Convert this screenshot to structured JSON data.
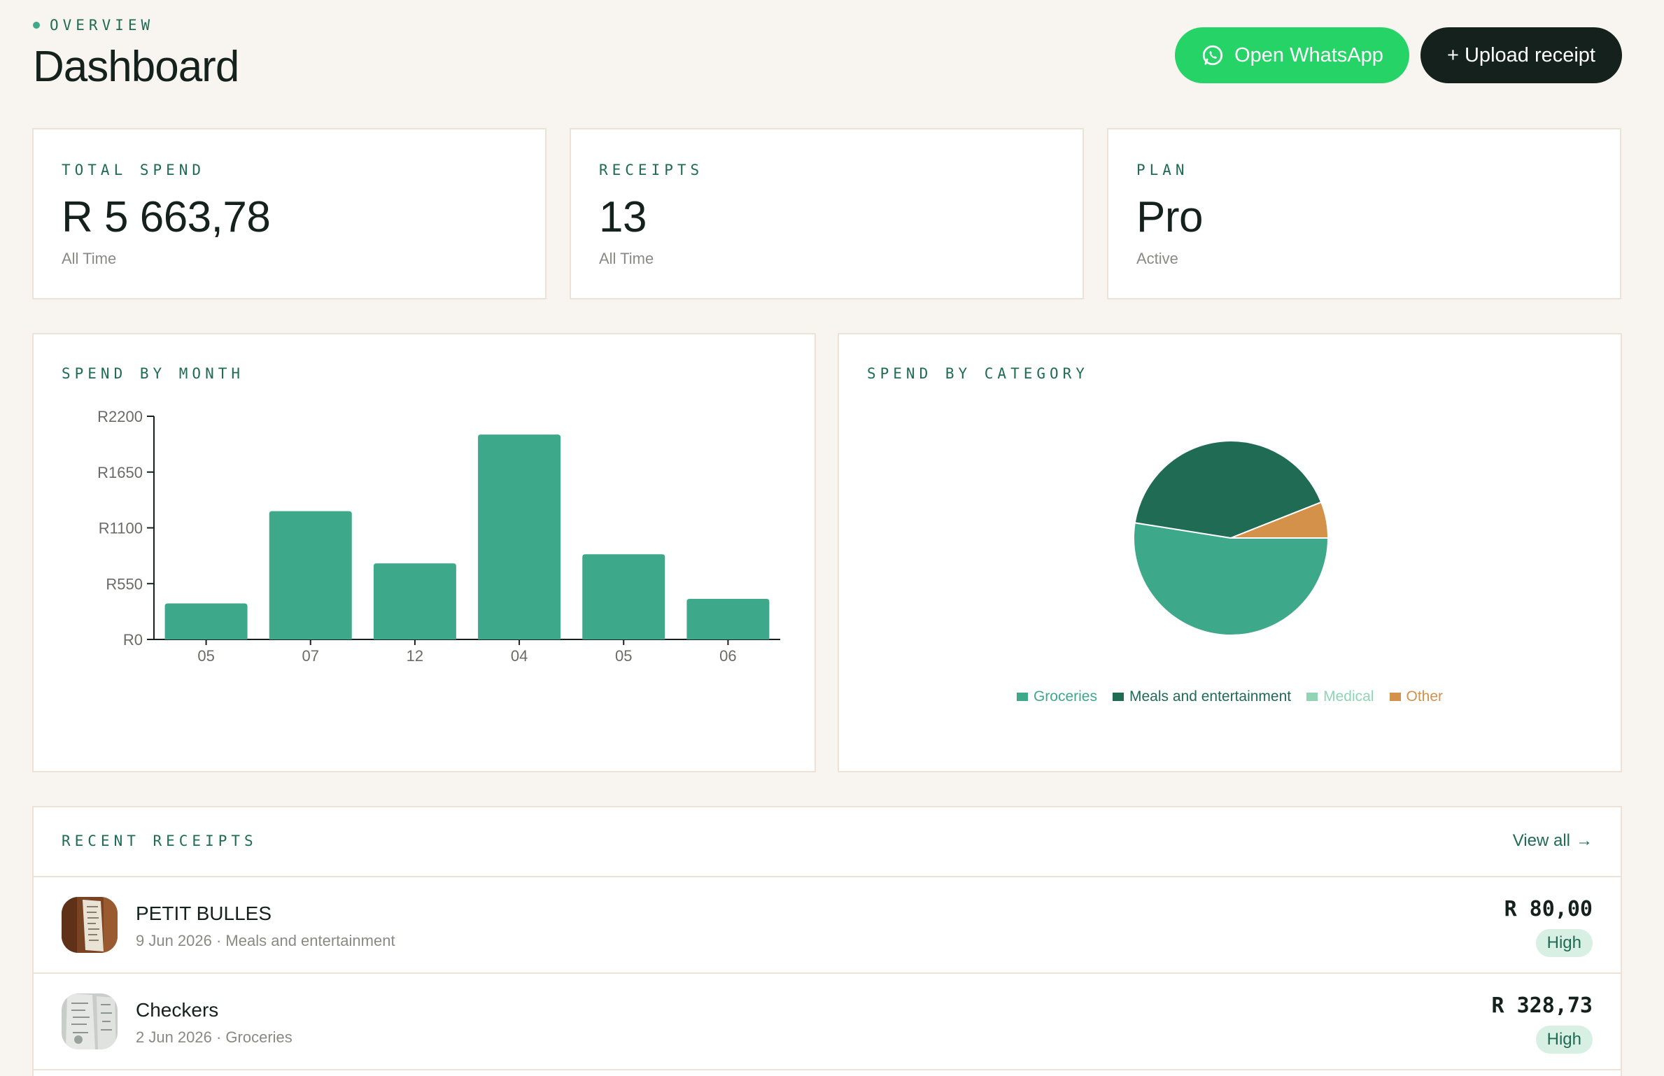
{
  "header": {
    "eyebrow": "OVERVIEW",
    "title": "Dashboard",
    "whatsapp_label": "Open WhatsApp",
    "upload_label": "+ Upload receipt"
  },
  "stats": [
    {
      "label": "TOTAL SPEND",
      "value": "R 5 663,78",
      "sub": "All Time"
    },
    {
      "label": "RECEIPTS",
      "value": "13",
      "sub": "All Time"
    },
    {
      "label": "PLAN",
      "value": "Pro",
      "sub": "Active"
    }
  ],
  "spend_by_month": {
    "label": "SPEND BY MONTH"
  },
  "spend_by_category": {
    "label": "SPEND BY CATEGORY",
    "legend": [
      {
        "name": "Groceries",
        "color": "#3ea98a"
      },
      {
        "name": "Meals and entertainment",
        "color": "#1f6b54"
      },
      {
        "name": "Medical",
        "color": "#8fd4b4"
      },
      {
        "name": "Other",
        "color": "#d3914a"
      }
    ]
  },
  "chart_data": [
    {
      "type": "bar",
      "title": "SPEND BY MONTH",
      "categories": [
        "05",
        "07",
        "12",
        "04",
        "05",
        "06"
      ],
      "values": [
        355,
        1265,
        750,
        2020,
        840,
        400
      ],
      "ylim": [
        0,
        2200
      ],
      "yticks": [
        "R0",
        "R550",
        "R1100",
        "R1650",
        "R2200"
      ],
      "ytick_values": [
        0,
        550,
        1100,
        1650,
        2200
      ],
      "color": "#3ea98a"
    },
    {
      "type": "pie",
      "title": "SPEND BY CATEGORY",
      "categories": [
        "Groceries",
        "Meals and entertainment",
        "Medical",
        "Other"
      ],
      "values": [
        52.5,
        41.5,
        0,
        6.0
      ],
      "colors": [
        "#3ea98a",
        "#1f6b54",
        "#8fd4b4",
        "#d3914a"
      ],
      "legend_position": "bottom"
    }
  ],
  "recent_receipts": {
    "label": "RECENT RECEIPTS",
    "view_all": "View all",
    "items": [
      {
        "name": "PETIT BULLES",
        "meta": "9 Jun 2026 · Meals and entertainment",
        "amount": "R 80,00",
        "badge": "High"
      },
      {
        "name": "Checkers",
        "meta": "2 Jun 2026 · Groceries",
        "amount": "R 328,73",
        "badge": "High"
      }
    ]
  }
}
